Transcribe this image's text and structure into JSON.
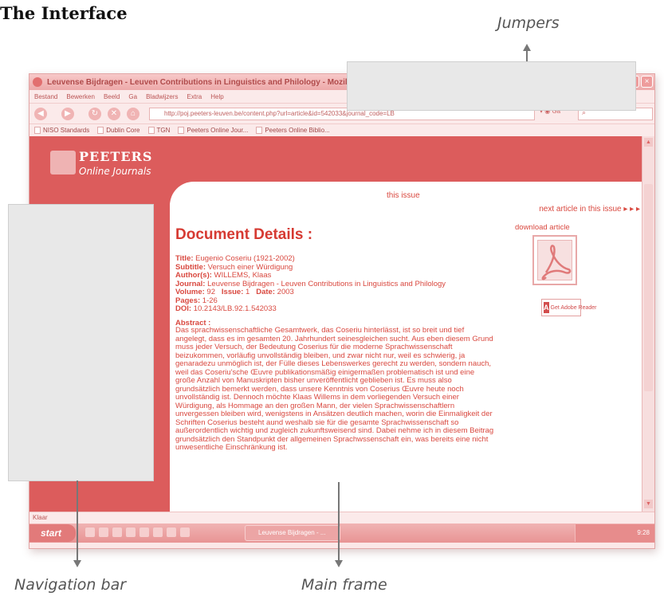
{
  "figure": {
    "title": "The Interface",
    "callouts": {
      "jumpers": "Jumpers",
      "navigation_bar": "Navigation bar",
      "main_frame": "Main frame"
    }
  },
  "browser": {
    "window_title": "Leuvense Bijdragen - Leuven Contributions in Linguistics and Philology - Mozilla Firefox",
    "menu": [
      "Bestand",
      "Bewerken",
      "Beeld",
      "Ga",
      "Bladwijzers",
      "Extra",
      "Help"
    ],
    "url": "http://poj.peeters-leuven.be/content.php?url=article&id=542033&journal_code=LB",
    "go_label": "Ga",
    "bookmarks": [
      "NISO Standards",
      "Dublin Core",
      "TGN",
      "Peeters Online Jour...",
      "Peeters Online Biblio..."
    ],
    "status_text": "Klaar",
    "taskbar": {
      "start_label": "start",
      "task_label": "Leuvense Bijdragen - ...",
      "clock": "9:28"
    },
    "window_buttons": [
      "_",
      "□",
      "×"
    ]
  },
  "page": {
    "logo_name": "PEETERS",
    "logo_sub": "Online Journals",
    "this_issue": "this issue",
    "next_article": "next article in this issue ▸ ▸ ▸",
    "heading": "Document Details :",
    "details": {
      "title_label": "Title:",
      "title": "Eugenio Coseriu (1921-2002)",
      "subtitle_label": "Subtitle:",
      "subtitle": "Versuch einer Würdigung",
      "authors_label": "Author(s):",
      "authors": "WILLEMS, Klaas",
      "journal_label": "Journal:",
      "journal": "Leuvense Bijdragen - Leuven Contributions in Linguistics and Philology",
      "volume_label": "Volume:",
      "volume": "92",
      "issue_label": "Issue:",
      "issue": "1",
      "date_label": "Date:",
      "date": "2003",
      "pages_label": "Pages:",
      "pages": "1-26",
      "doi_label": "DOI:",
      "doi": "10.2143/LB.92.1.542033"
    },
    "abstract_label": "Abstract :",
    "abstract": "Das sprachwissenschaftliche Gesamtwerk, das Coseriu hinterlässt, ist so breit und tief angelegt, dass es im gesamten 20. Jahrhundert seinesgleichen sucht. Aus eben diesem Grund muss jeder Versuch, der Bedeutung Coserius für die moderne Sprachwissenschaft beizukommen, vorläufig unvollständig bleiben, und zwar nicht nur, weil es schwierig, ja genaradezu unmöglich ist, der Fülle dieses Lebenswerkes gerecht zu werden, sondern nauch, weil das Coseriu'sche Œuvre publikationsmäßig einigermaßen problematisch ist und eine große Anzahl von Manuskripten bisher unveröffentlicht geblieben ist. Es muss also grundsätzlich bemerkt werden, dass unsere Kenntnis von Coserius Œuvre heute noch unvollständig ist. Dennoch möchte Klaas Willems in dem vorliegenden Versuch einer Würdigung, als Hommage an den großen Mann, der vielen Sprachwissenschaftlern unvergessen bleiben wird, wenigstens in Ansätzen deutlich machen, worin die Einmaligkeit der Schriften Coserius besteht aund weshalb sie für die gesamte Sprachwissenschaft so außerordentlich wichtig und zugleich zukunftsweisend sind. Dabei nehme ich in diesem Beitrag grundsätzlich den Standpunkt der allgemeinen Sprachwssenschaft ein, was bereits eine nicht unwesentliche Einschränkung ist.",
    "download_article": "download article",
    "adobe_badge": "Get Adobe Reader"
  },
  "colors": {
    "page_red": "#dc5c5c",
    "text_red": "#d9483f",
    "highlight_gray": "#e8e8e8"
  }
}
